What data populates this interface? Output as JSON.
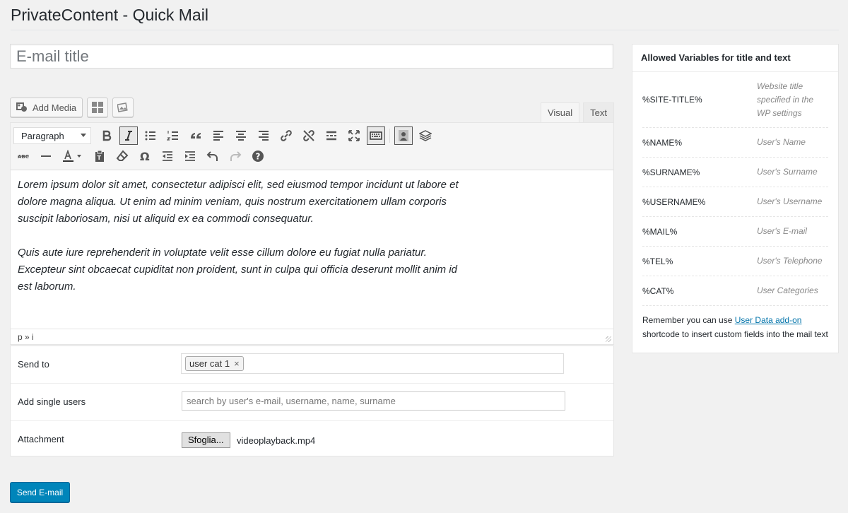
{
  "page": {
    "title": "PrivateContent - Quick Mail"
  },
  "email": {
    "title_placeholder": "E-mail title"
  },
  "media_bar": {
    "add_media_label": "Add Media"
  },
  "editor": {
    "tabs": {
      "visual": "Visual",
      "text": "Text"
    },
    "format_select_value": "Paragraph",
    "content": {
      "paragraph_1": "Lorem ipsum dolor sit amet, consectetur adipisci elit, sed eiusmod tempor incidunt ut labore et dolore magna aliqua. Ut enim ad minim veniam, quis nostrum exercitationem ullam corporis suscipit laboriosam, nisi ut aliquid ex ea commodi consequatur.",
      "paragraph_2": "Quis aute iure reprehenderit in voluptate velit esse cillum dolore eu fugiat nulla pariatur. Excepteur sint obcaecat cupiditat non proident, sunt in culpa qui officia deserunt mollit anim id est laborum."
    },
    "path": "p » i"
  },
  "form": {
    "send_to": {
      "label": "Send to",
      "chip": "user cat 1",
      "chip_remove": "×"
    },
    "add_users": {
      "label": "Add single users",
      "placeholder": "search by user's e-mail, username, name, surname"
    },
    "attachment": {
      "label": "Attachment",
      "browse_label": "Sfoglia...",
      "file_name": "videoplayback.mp4"
    }
  },
  "actions": {
    "send_label": "Send E-mail"
  },
  "sidebar": {
    "title": "Allowed Variables for title and text",
    "variables": [
      {
        "name": "%SITE-TITLE%",
        "desc": "Website title specified in the WP settings"
      },
      {
        "name": "%NAME%",
        "desc": "User's Name"
      },
      {
        "name": "%SURNAME%",
        "desc": "User's Surname"
      },
      {
        "name": "%USERNAME%",
        "desc": "User's Username"
      },
      {
        "name": "%MAIL%",
        "desc": "User's E-mail"
      },
      {
        "name": "%TEL%",
        "desc": "User's Telephone"
      },
      {
        "name": "%CAT%",
        "desc": "User Categories"
      }
    ],
    "note_before": "Remember you can use ",
    "note_link": "User Data add-on",
    "note_after": " shortcode to insert custom fields into the mail text"
  },
  "colors": {
    "primary_button": "#0085ba",
    "link": "#0073aa",
    "background": "#f1f1f1"
  }
}
